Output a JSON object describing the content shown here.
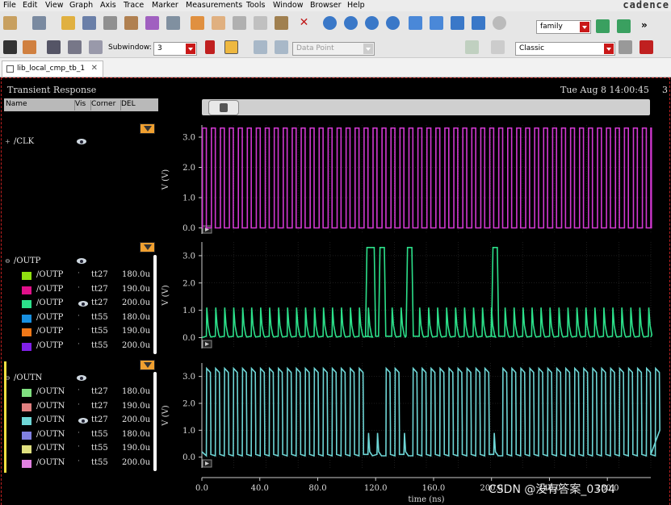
{
  "menu": {
    "items": [
      {
        "label": "File",
        "key": "F"
      },
      {
        "label": "Edit",
        "key": "E"
      },
      {
        "label": "View",
        "key": "V"
      },
      {
        "label": "Graph",
        "key": "G"
      },
      {
        "label": "Axis",
        "key": "A"
      },
      {
        "label": "Trace",
        "key": "T"
      },
      {
        "label": "Marker",
        "key": "M"
      },
      {
        "label": "Measurements",
        "key": "M"
      },
      {
        "label": "Tools",
        "key": "T"
      },
      {
        "label": "Window",
        "key": "W"
      },
      {
        "label": "Browser",
        "key": "B"
      },
      {
        "label": "Help",
        "key": "H"
      }
    ],
    "logo": "cadence"
  },
  "toolbar": {
    "search_value": "family",
    "subwindow_label": "Subwindow:",
    "subwindow_value": "3",
    "data_point_placeholder": "Data Point",
    "style_value": "Classic",
    "more_glyph": "»"
  },
  "tab": {
    "label": "lib_local_cmp_tb_1",
    "close": "✕"
  },
  "window": {
    "title": "Transient Response",
    "date": "Tue Aug 8 14:00:45",
    "date_trail": "3"
  },
  "colors": {
    "clk": "#d238d2",
    "outp": "#2ce08a",
    "outn": "#6ed6d6",
    "grid": "#3a3a3a",
    "axis": "#cccccc"
  },
  "legend": {
    "headers": {
      "name": "Name",
      "vis": "Vis",
      "corner": "Corner",
      "del": "DEL"
    },
    "groups": [
      {
        "name": "/CLK",
        "toggle": "+",
        "signals": []
      },
      {
        "name": "/OUTP",
        "toggle": "⊖",
        "signals": [
          {
            "name": "/OUTP",
            "color": "#90e010",
            "corner": "tt27",
            "del": "180.0u",
            "visible": false
          },
          {
            "name": "/OUTP",
            "color": "#e0108a",
            "corner": "tt27",
            "del": "190.0u",
            "visible": false
          },
          {
            "name": "/OUTP",
            "color": "#2ce08a",
            "corner": "tt27",
            "del": "200.0u",
            "visible": true
          },
          {
            "name": "/OUTP",
            "color": "#1890e0",
            "corner": "tt55",
            "del": "180.0u",
            "visible": false
          },
          {
            "name": "/OUTP",
            "color": "#f07818",
            "corner": "tt55",
            "del": "190.0u",
            "visible": false
          },
          {
            "name": "/OUTP",
            "color": "#8020e8",
            "corner": "tt55",
            "del": "200.0u",
            "visible": false
          }
        ]
      },
      {
        "name": "/OUTN",
        "toggle": "⊖",
        "signals": [
          {
            "name": "/OUTN",
            "color": "#80e080",
            "corner": "tt27",
            "del": "180.0u",
            "visible": false
          },
          {
            "name": "/OUTN",
            "color": "#e08080",
            "corner": "tt27",
            "del": "190.0u",
            "visible": false
          },
          {
            "name": "/OUTN",
            "color": "#6ed6d6",
            "corner": "tt27",
            "del": "200.0u",
            "visible": true
          },
          {
            "name": "/OUTN",
            "color": "#8080e0",
            "corner": "tt55",
            "del": "180.0u",
            "visible": false
          },
          {
            "name": "/OUTN",
            "color": "#e0e080",
            "corner": "tt55",
            "del": "190.0u",
            "visible": false
          },
          {
            "name": "/OUTN",
            "color": "#e080e0",
            "corner": "tt55",
            "del": "200.0u",
            "visible": false
          }
        ]
      }
    ]
  },
  "chart_data": [
    {
      "type": "line",
      "series": [
        {
          "name": "/CLK",
          "color": "#d238d2"
        }
      ],
      "ylabel": "V (V)",
      "yticks": [
        "0.0",
        "1.0",
        "2.0",
        "3.0"
      ],
      "ylim": [
        -0.2,
        3.4
      ],
      "xlim": [
        0,
        310
      ],
      "clock_period_ns": 6.2,
      "high": 3.3,
      "low": 0.0
    },
    {
      "type": "line",
      "series": [
        {
          "name": "/OUTP",
          "color": "#2ce08a"
        }
      ],
      "ylabel": "V (V)",
      "yticks": [
        "0.0",
        "1.0",
        "2.0",
        "3.0"
      ],
      "ylim": [
        -0.4,
        3.5
      ],
      "xlim": [
        0,
        310
      ],
      "spike_height": 1.1,
      "high_pulses_ns": [
        [
          113,
          120
        ],
        [
          122,
          127
        ],
        [
          141,
          146
        ],
        [
          200,
          205
        ]
      ]
    },
    {
      "type": "line",
      "series": [
        {
          "name": "/OUTN",
          "color": "#6ed6d6"
        }
      ],
      "ylabel": "V (V)",
      "yticks": [
        "0.0",
        "1.0",
        "2.0",
        "3.0"
      ],
      "ylim": [
        -0.4,
        3.5
      ],
      "xlim": [
        0,
        310
      ],
      "xlabel": "time (ns)",
      "xticks": [
        "0.0",
        "40.0",
        "80.0",
        "120.0",
        "160.0",
        "200.0",
        "240.0",
        "280.0"
      ],
      "xtick_values": [
        0,
        40,
        80,
        120,
        160,
        200,
        240,
        280
      ]
    }
  ],
  "watermark": "CSDN @没有答案_0304"
}
